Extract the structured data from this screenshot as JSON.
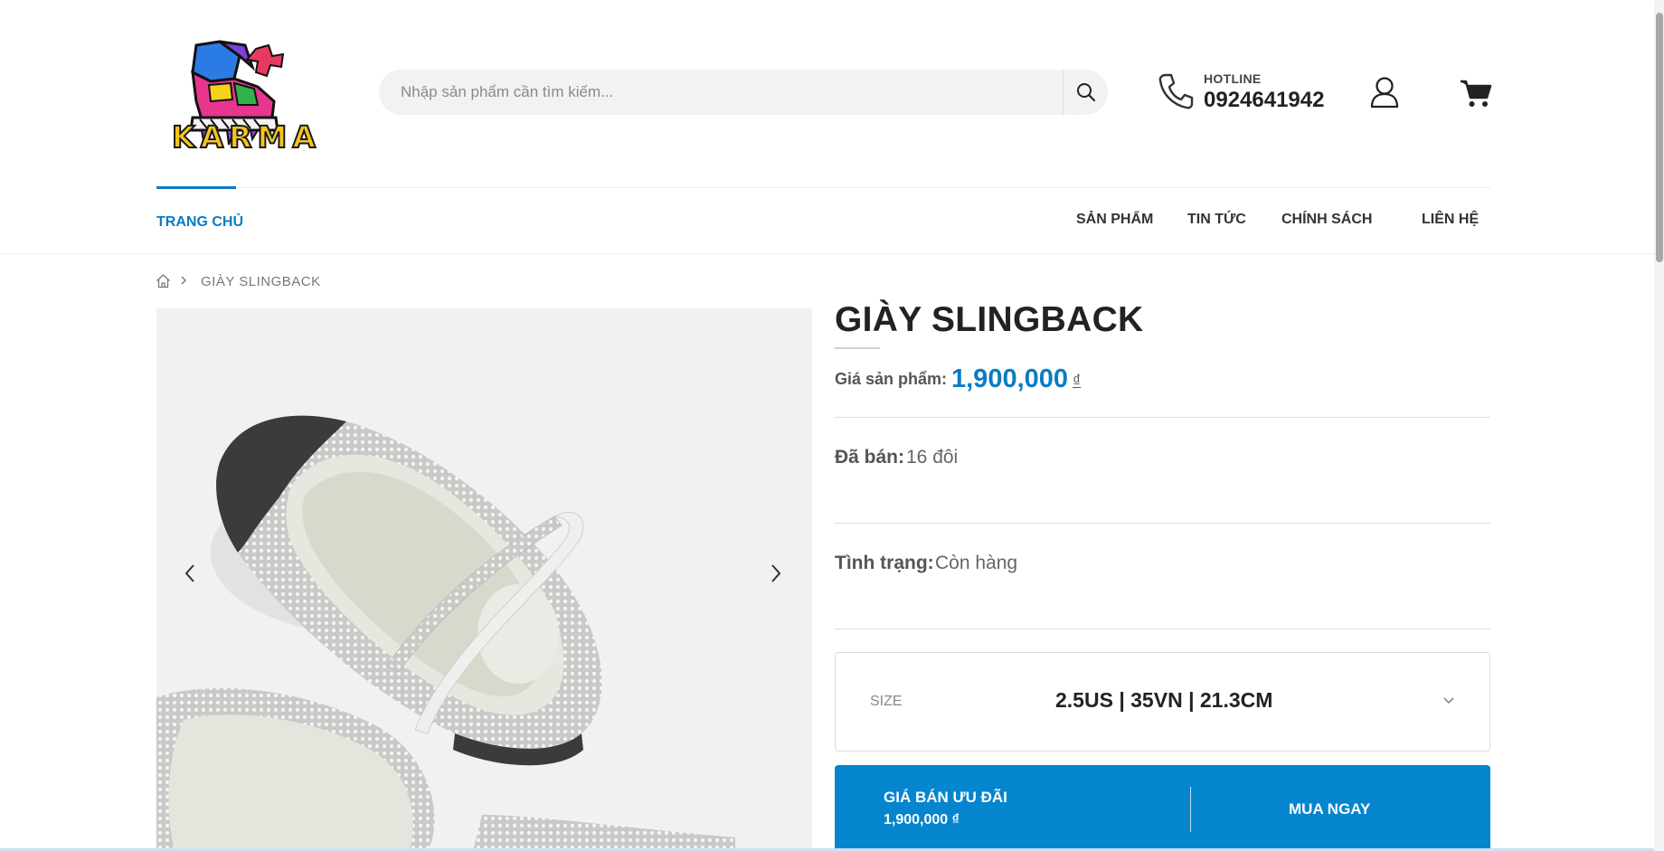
{
  "header": {
    "logo_text": "KARMA",
    "search_placeholder": "Nhập sản phẩm cần tìm kiếm...",
    "hotline_label": "HOTLINE",
    "hotline_number": "0924641942"
  },
  "nav": {
    "home": "TRANG CHỦ",
    "items": [
      "SẢN PHẨM",
      "TIN TỨC",
      "CHÍNH SÁCH",
      "LIÊN HỆ"
    ]
  },
  "breadcrumb": {
    "current": "GIÀY SLINGBACK"
  },
  "product": {
    "title": "GIÀY SLINGBACK",
    "price_label": "Giá sản phẩm:",
    "price": "1,900,000",
    "currency": "₫",
    "sold_label": "Đã bán:",
    "sold_value": "16 đôi",
    "status_label": "Tình trạng:",
    "status_value": "Còn hàng",
    "size_label": "SIZE",
    "size_value": "2.5US | 35VN | 21.3CM",
    "deal_label": "GIÁ BÁN ƯU ĐÃI",
    "deal_price": "1,900,000 ₫",
    "buy_now": "MUA NGAY"
  },
  "colors": {
    "accent": "#0a7cc4",
    "buy_button": "#0585ce"
  },
  "icons": [
    "search-icon",
    "phone-icon",
    "user-icon",
    "cart-icon",
    "home-icon",
    "chevron-right-icon",
    "arrow-left-icon",
    "arrow-right-icon",
    "chevron-down-icon"
  ]
}
